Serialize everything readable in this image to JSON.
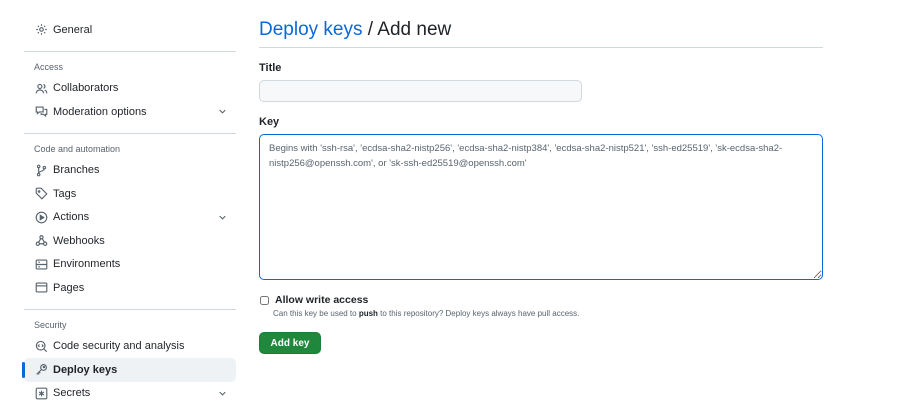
{
  "sidebar": {
    "general": "General",
    "sections": {
      "access": "Access",
      "code_automation": "Code and automation",
      "security": "Security"
    },
    "items": {
      "collaborators": "Collaborators",
      "moderation": "Moderation options",
      "branches": "Branches",
      "tags": "Tags",
      "actions": "Actions",
      "webhooks": "Webhooks",
      "environments": "Environments",
      "pages": "Pages",
      "code_security": "Code security and analysis",
      "deploy_keys": "Deploy keys",
      "secrets": "Secrets"
    },
    "active_item": "deploy_keys"
  },
  "page": {
    "breadcrumb_link": "Deploy keys",
    "breadcrumb_rest": " / Add new"
  },
  "form": {
    "title_label": "Title",
    "title_value": "",
    "key_label": "Key",
    "key_placeholder": "Begins with 'ssh-rsa', 'ecdsa-sha2-nistp256', 'ecdsa-sha2-nistp384', 'ecdsa-sha2-nistp521', 'ssh-ed25519', 'sk-ecdsa-sha2-nistp256@openssh.com', or 'sk-ssh-ed25519@openssh.com'",
    "write_access_label": "Allow write access",
    "write_access_checked": false,
    "help_prefix": "Can this key be used to ",
    "help_bold": "push",
    "help_suffix": " to this repository? Deploy keys always have pull access.",
    "submit_label": "Add key"
  },
  "colors": {
    "accent": "#0969da",
    "primary_button": "#1f883d",
    "muted_text": "#59636e",
    "border": "#d1d9e0"
  },
  "icons": {
    "general": "gear-icon",
    "collaborators": "people-icon",
    "moderation": "comment-discussion-icon",
    "branches": "git-branch-icon",
    "tags": "tag-icon",
    "actions": "play-icon",
    "webhooks": "webhook-icon",
    "environments": "server-icon",
    "pages": "browser-icon",
    "code_security": "codescan-icon",
    "deploy_keys": "key-icon",
    "secrets": "asterisk-icon",
    "expand": "chevron-down-icon"
  }
}
